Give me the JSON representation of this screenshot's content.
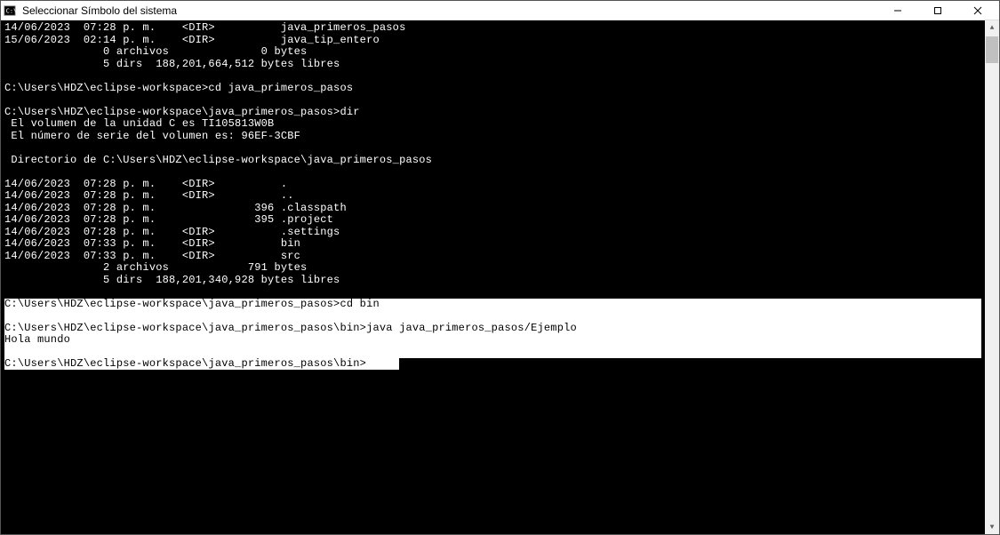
{
  "window": {
    "title": "Seleccionar Símbolo del sistema"
  },
  "terminal": {
    "lines": [
      "14/06/2023  07:28 p. m.    <DIR>          java_primeros_pasos",
      "15/06/2023  02:14 p. m.    <DIR>          java_tip_entero",
      "               0 archivos              0 bytes",
      "               5 dirs  188,201,664,512 bytes libres",
      "",
      "C:\\Users\\HDZ\\eclipse-workspace>cd java_primeros_pasos",
      "",
      "C:\\Users\\HDZ\\eclipse-workspace\\java_primeros_pasos>dir",
      " El volumen de la unidad C es TI105813W0B",
      " El número de serie del volumen es: 96EF-3CBF",
      "",
      " Directorio de C:\\Users\\HDZ\\eclipse-workspace\\java_primeros_pasos",
      "",
      "14/06/2023  07:28 p. m.    <DIR>          .",
      "14/06/2023  07:28 p. m.    <DIR>          ..",
      "14/06/2023  07:28 p. m.               396 .classpath",
      "14/06/2023  07:28 p. m.               395 .project",
      "14/06/2023  07:28 p. m.    <DIR>          .settings",
      "14/06/2023  07:33 p. m.    <DIR>          bin",
      "14/06/2023  07:33 p. m.    <DIR>          src",
      "               2 archivos            791 bytes",
      "               5 dirs  188,201,340,928 bytes libres",
      ""
    ],
    "selected_lines": [
      "C:\\Users\\HDZ\\eclipse-workspace\\java_primeros_pasos>cd bin",
      "",
      "C:\\Users\\HDZ\\eclipse-workspace\\java_primeros_pasos\\bin>java java_primeros_pasos/Ejemplo",
      "Hola mundo",
      ""
    ],
    "last_prompt_prefix": "C:\\Users\\HDZ\\eclipse-workspace\\java_primeros_pasos\\bin>"
  }
}
